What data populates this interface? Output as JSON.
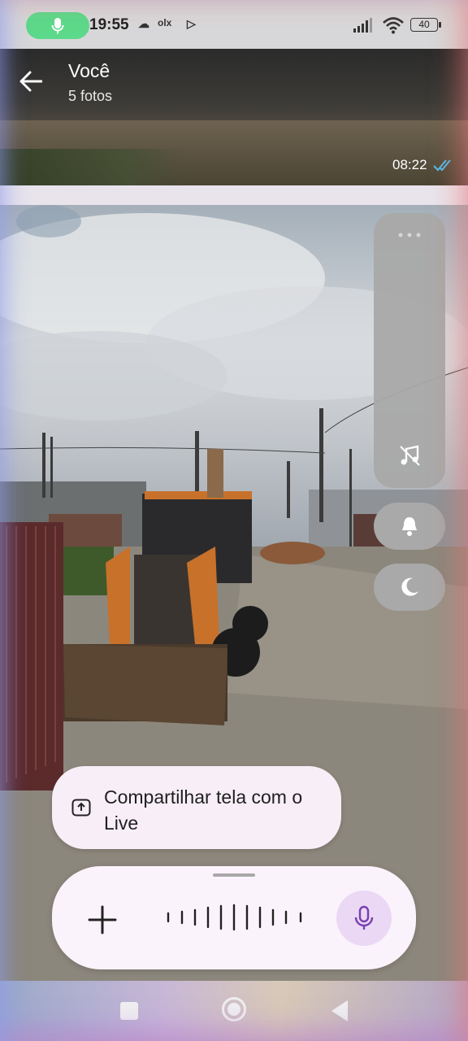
{
  "status": {
    "time": "19:55",
    "glyph_a": "☁",
    "glyph_b": "olx",
    "glyph_c": "▷",
    "battery": "40"
  },
  "header": {
    "title": "Você",
    "subtitle": "5 fotos",
    "message_time": "08:22"
  },
  "share_chip": {
    "label": "Compartilhar tela com o Live"
  },
  "live_bar": {
    "mic_color": "#7a3fb0"
  },
  "colors": {
    "mic_pill": "#5cd98a",
    "panel": "#a9a9a9",
    "chip_bg": "#f7eef7",
    "ticks": "#53bdeb"
  }
}
